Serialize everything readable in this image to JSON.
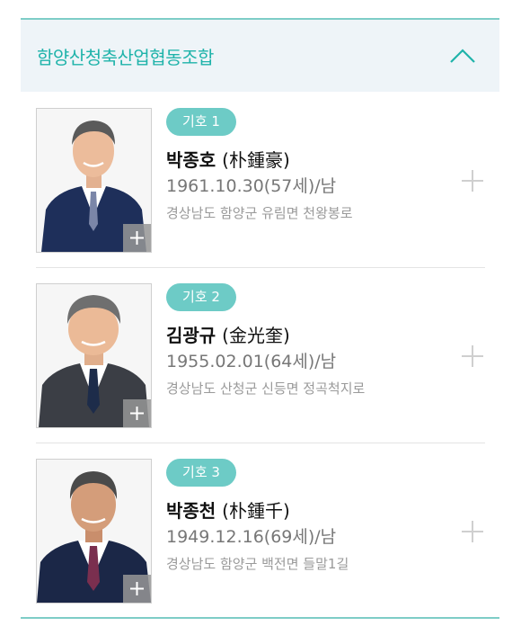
{
  "group": {
    "title": "함양산청축산업협동조합",
    "expanded": true
  },
  "candidates": [
    {
      "badge": "기호 1",
      "name": "박종호",
      "hanja": "(朴鍾豪)",
      "birth": "1961.10.30(57세)/남",
      "address": "경상남도 함양군 유림면 천왕봉로"
    },
    {
      "badge": "기호 2",
      "name": "김광규",
      "hanja": "(金光奎)",
      "birth": "1955.02.01(64세)/남",
      "address": "경상남도 산청군 신등면 정곡척지로"
    },
    {
      "badge": "기호 3",
      "name": "박종천",
      "hanja": "(朴鍾千)",
      "birth": "1949.12.16(69세)/남",
      "address": "경상남도 함양군 백전면 들말1길"
    }
  ],
  "colors": {
    "accent": "#1fb3aa",
    "badge": "#6dcbc6",
    "header_bg": "#eef4f8"
  },
  "icons": {
    "header_toggle": "chevron-up-icon",
    "photo_zoom": "plus-icon",
    "row_expand": "plus-icon"
  }
}
